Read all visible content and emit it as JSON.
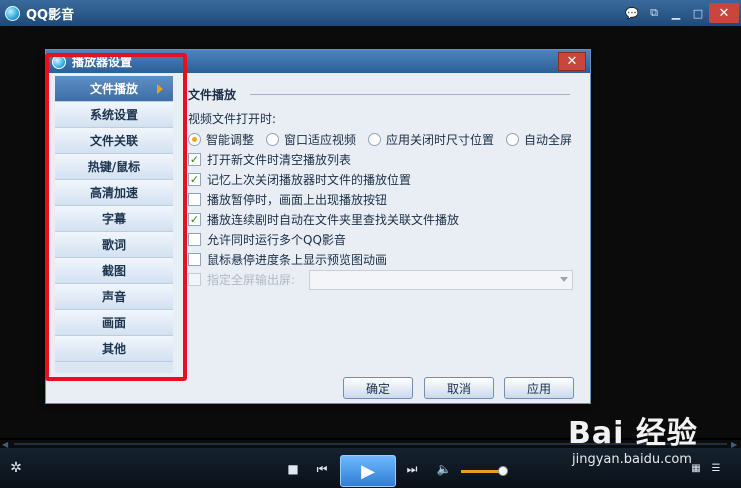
{
  "app": {
    "title": "QQ影音",
    "titlebar_icons": [
      "chat-icon",
      "window-mode-icon",
      "minimize-icon",
      "maximize-icon",
      "close-icon"
    ]
  },
  "dialog": {
    "title": "播放器设置",
    "sidebar": [
      {
        "label": "文件播放",
        "active": true
      },
      {
        "label": "系统设置",
        "active": false
      },
      {
        "label": "文件关联",
        "active": false
      },
      {
        "label": "热键/鼠标",
        "active": false
      },
      {
        "label": "高清加速",
        "active": false
      },
      {
        "label": "字幕",
        "active": false
      },
      {
        "label": "歌词",
        "active": false
      },
      {
        "label": "截图",
        "active": false
      },
      {
        "label": "声音",
        "active": false
      },
      {
        "label": "画面",
        "active": false
      },
      {
        "label": "其他",
        "active": false
      }
    ],
    "section_title": "文件播放",
    "open_label": "视频文件打开时:",
    "radios": [
      {
        "label": "智能调整",
        "selected": true
      },
      {
        "label": "窗口适应视频",
        "selected": false
      },
      {
        "label": "应用关闭时尺寸位置",
        "selected": false
      },
      {
        "label": "自动全屏",
        "selected": false
      }
    ],
    "checkboxes": [
      {
        "label": "打开新文件时清空播放列表",
        "checked": true
      },
      {
        "label": "记忆上次关闭播放器时文件的播放位置",
        "checked": true
      },
      {
        "label": "播放暂停时，画面上出现播放按钮",
        "checked": false
      },
      {
        "label": "播放连续剧时自动在文件夹里查找关联文件播放",
        "checked": true
      },
      {
        "label": "允许同时运行多个QQ影音",
        "checked": false
      },
      {
        "label": "鼠标悬停进度条上显示预览图动画",
        "checked": false
      }
    ],
    "fullscreen_output": {
      "label": "指定全屏输出屏:",
      "value": "",
      "disabled": true
    },
    "buttons": {
      "ok": "确定",
      "cancel": "取消",
      "apply": "应用"
    }
  },
  "watermark": {
    "main": "Bai 经验",
    "sub": "jingyan.baidu.com"
  },
  "colors": {
    "highlight": "#e8101e",
    "accent": "#f39a1f",
    "dialog_title": "#2b5f98"
  }
}
